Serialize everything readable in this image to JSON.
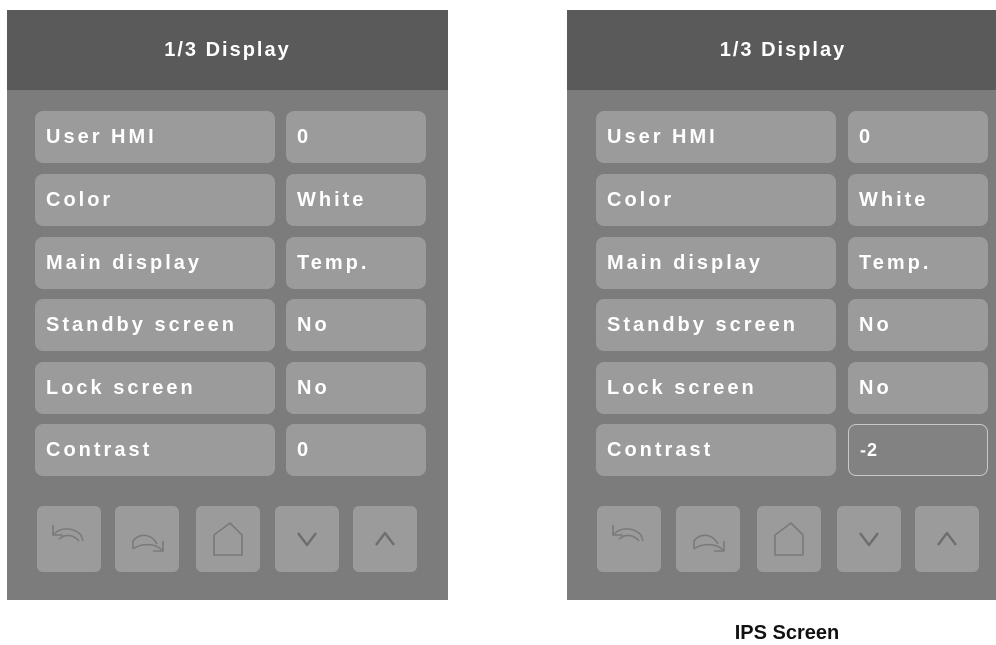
{
  "screens": [
    {
      "title": "1/3 Display",
      "rows": [
        {
          "label": "User HMI",
          "value": "0"
        },
        {
          "label": "Color",
          "value": "White"
        },
        {
          "label": "Main display",
          "value": "Temp."
        },
        {
          "label": "Standby screen",
          "value": "No"
        },
        {
          "label": "Lock screen",
          "value": "No"
        },
        {
          "label": "Contrast",
          "value": "0"
        }
      ]
    },
    {
      "title": "1/3 Display",
      "rows": [
        {
          "label": "User HMI",
          "value": "0"
        },
        {
          "label": "Color",
          "value": "White"
        },
        {
          "label": "Main display",
          "value": "Temp."
        },
        {
          "label": "Standby screen",
          "value": "No"
        },
        {
          "label": "Lock screen",
          "value": "No"
        },
        {
          "label": "Contrast",
          "value": "-2"
        }
      ],
      "caption": "IPS Screen"
    }
  ],
  "nav_icons": [
    "undo-icon",
    "redo-icon",
    "home-icon",
    "chevron-down-icon",
    "chevron-up-icon"
  ],
  "colors": {
    "panel": "#7c7c7c",
    "header": "#5a5a5a",
    "button": "#9b9b9b",
    "text": "#ffffff"
  }
}
